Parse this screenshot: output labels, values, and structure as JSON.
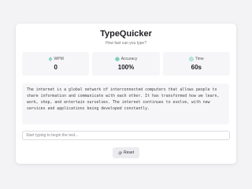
{
  "app": {
    "title": "TypeQuicker",
    "subtitle": "How fast can you type?"
  },
  "stats": {
    "wpm": {
      "label": "WPM",
      "value": "0",
      "icon": "lightning-icon"
    },
    "accuracy": {
      "label": "Accuracy",
      "value": "100%",
      "icon": "target-icon"
    },
    "time": {
      "label": "Time",
      "value": "60s",
      "icon": "clock-icon"
    }
  },
  "passage": {
    "text": "The internet is a global network of interconnected computers that allows people to share information and communicate with each other. It has transformed how we learn, work, shop, and entertain ourselves. The internet continues to evolve, with new services and applications being developed constantly."
  },
  "input": {
    "value": "",
    "placeholder": "Start typing to begin the test..."
  },
  "reset": {
    "label": "Reset",
    "icon": "refresh-icon"
  },
  "colors": {
    "background": "#f3f3f5",
    "card": "#ffffff",
    "accent": "#2bb39a"
  }
}
